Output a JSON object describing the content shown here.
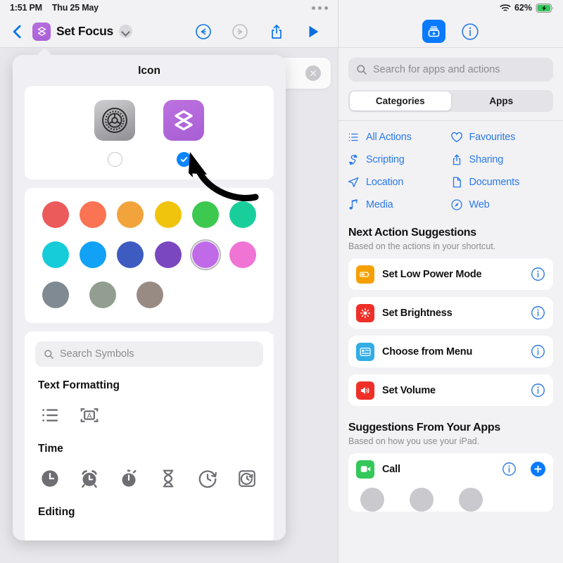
{
  "left": {
    "status": {
      "time": "1:51 PM",
      "date": "Thu 25 May"
    },
    "toolbar": {
      "back_icon": "chevron-left-icon",
      "app_icon": "shortcuts-layers-icon",
      "title": "Set Focus",
      "title_chevron_icon": "chevron-down-icon",
      "undo_icon": "undo-icon",
      "redo_icon": "redo-icon",
      "share_icon": "share-icon",
      "play_icon": "play-icon"
    },
    "popover": {
      "title": "Icon",
      "icon_choices": [
        {
          "name": "settings-gear-icon",
          "selected": false,
          "label": "Settings App Icon"
        },
        {
          "name": "shortcuts-layers-icon",
          "selected": true,
          "label": "Shortcuts Glyph Icon"
        }
      ],
      "colors": [
        [
          {
            "name": "red",
            "hex": "#ec5b5b",
            "selected": false
          },
          {
            "name": "coral",
            "hex": "#fa7352",
            "selected": false
          },
          {
            "name": "orange",
            "hex": "#f3a33c",
            "selected": false
          },
          {
            "name": "yellow",
            "hex": "#f0c40d",
            "selected": false
          },
          {
            "name": "green",
            "hex": "#3dc council",
            "selected": false
          },
          {
            "name": "teal",
            "hex": "#18cf9c",
            "selected": false
          }
        ],
        [
          {
            "name": "cyan",
            "hex": "#16ccd8",
            "selected": false
          },
          {
            "name": "blue",
            "hex": "#12a2f5",
            "selected": false
          },
          {
            "name": "indigo",
            "hex": "#3d5bc0",
            "selected": false
          },
          {
            "name": "purple",
            "hex": "#7b47c0",
            "selected": false
          },
          {
            "name": "light-purple",
            "hex": "#c06ae8",
            "selected": true
          },
          {
            "name": "pink",
            "hex": "#f074d4",
            "selected": false
          }
        ],
        [
          {
            "name": "slate-gray",
            "hex": "#7f8a92",
            "selected": false
          },
          {
            "name": "sage-gray",
            "hex": "#929e90",
            "selected": false
          },
          {
            "name": "taupe",
            "hex": "#988b84",
            "selected": false
          }
        ]
      ],
      "symbol_search_placeholder": "Search Symbols",
      "symbol_groups": [
        {
          "title": "Text Formatting",
          "symbols": [
            "bullet-list-icon",
            "text-in-box-icon"
          ]
        },
        {
          "title": "Time",
          "symbols": [
            "clock-filled-icon",
            "alarm-clock-icon",
            "stopwatch-filled-icon",
            "hourglass-icon",
            "timer-outline-icon",
            "timer-square-icon"
          ]
        },
        {
          "title": "Editing",
          "symbols": []
        }
      ]
    },
    "background_card": {
      "close_icon": "close-circle-icon"
    },
    "annotation": {
      "arrow_icon": "curved-arrow-annotation"
    }
  },
  "right": {
    "status": {
      "wifi_icon": "wifi-icon",
      "battery_percent": "62%",
      "battery_icon": "battery-charging-icon"
    },
    "toolbar": {
      "library_icon": "shortcut-details-icon",
      "info_icon": "info-circle-icon"
    },
    "search": {
      "placeholder": "Search for apps and actions",
      "icon": "search-icon",
      "value": ""
    },
    "segmented": {
      "options": [
        "Categories",
        "Apps"
      ],
      "selected": "Categories"
    },
    "categories": [
      {
        "label": "All Actions",
        "icon": "list-bullet-icon"
      },
      {
        "label": "Favourites",
        "icon": "heart-icon"
      },
      {
        "label": "Scripting",
        "icon": "scripting-icon"
      },
      {
        "label": "Sharing",
        "icon": "share-icon"
      },
      {
        "label": "Location",
        "icon": "location-arrow-icon"
      },
      {
        "label": "Documents",
        "icon": "document-icon"
      },
      {
        "label": "Media",
        "icon": "music-note-icon"
      },
      {
        "label": "Web",
        "icon": "safari-compass-icon"
      }
    ],
    "next_actions": {
      "title": "Next Action Suggestions",
      "subtitle": "Based on the actions in your shortcut.",
      "items": [
        {
          "label": "Set Low Power Mode",
          "icon": "battery-icon",
          "color": "#f5a000",
          "info_icon": "info-circle-icon"
        },
        {
          "label": "Set Brightness",
          "icon": "brightness-icon",
          "color": "#f03028",
          "info_icon": "info-circle-icon"
        },
        {
          "label": "Choose from Menu",
          "icon": "menu-card-icon",
          "color": "#32ade6",
          "info_icon": "info-circle-icon"
        },
        {
          "label": "Set Volume",
          "icon": "speaker-icon",
          "color": "#f03028",
          "info_icon": "info-circle-icon"
        }
      ]
    },
    "app_suggestions": {
      "title": "Suggestions From Your Apps",
      "subtitle": "Based on how you use your iPad.",
      "items": [
        {
          "label": "Call",
          "icon": "facetime-video-icon",
          "color": "#34c759",
          "info_icon": "info-circle-icon",
          "add_icon": "plus-circle-icon"
        }
      ]
    }
  }
}
